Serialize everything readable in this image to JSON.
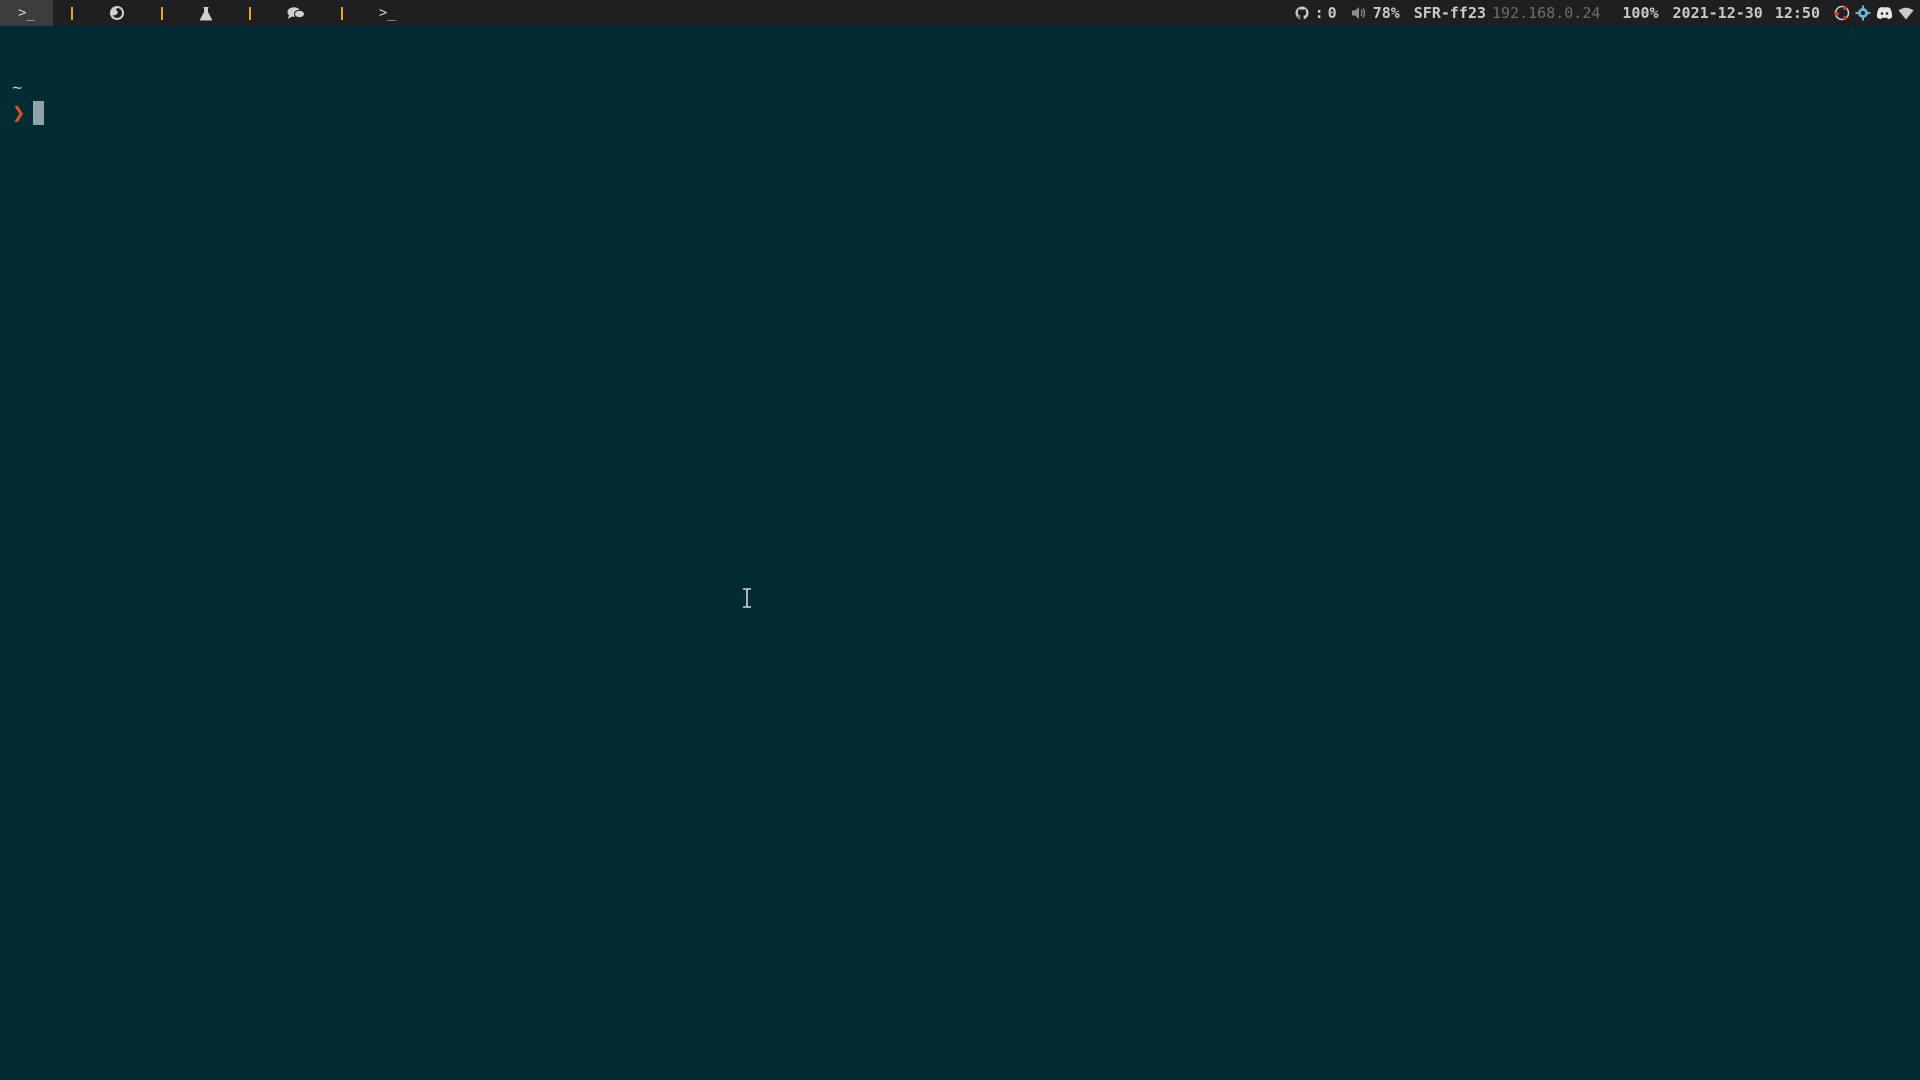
{
  "topbar": {
    "workspaces": [
      {
        "icon": "terminal-prompt-icon",
        "glyph": ">_",
        "active": true
      },
      {
        "icon": "firefox-icon",
        "active": false
      },
      {
        "icon": "flask-icon",
        "active": false
      },
      {
        "icon": "chat-bubbles-icon",
        "active": false
      },
      {
        "icon": "terminal-prompt-icon",
        "glyph": ">_",
        "active": false
      }
    ],
    "separator_color": "#e5a823",
    "status": {
      "github_separator": ":",
      "github_count": "0",
      "volume": "78%",
      "network_name": "SFR-ff23",
      "ip_address": "192.168.0.24",
      "battery": "100%",
      "date": "2021-12-30",
      "time": "12:50"
    },
    "tray_icons": [
      "ubuntu-icon",
      "gear-tray-icon",
      "discord-icon",
      "wifi-icon"
    ]
  },
  "terminal": {
    "cwd": "~",
    "prompt_symbol": "❯",
    "background_color": "#022b34",
    "prompt_color": "#d9541e"
  }
}
